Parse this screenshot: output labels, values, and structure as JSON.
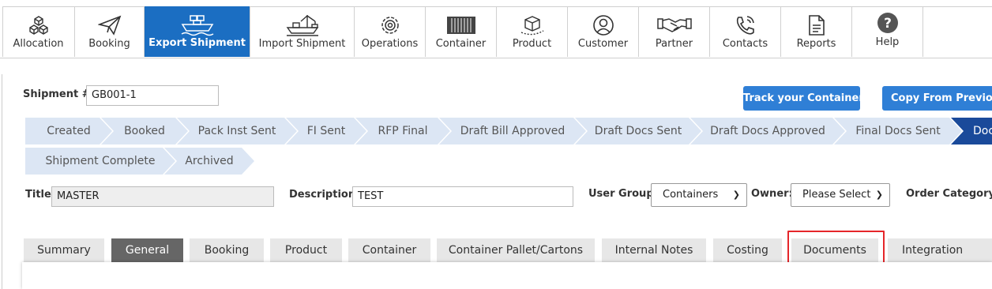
{
  "nav": {
    "items": [
      {
        "label": "Allocation",
        "icon": "allocation-icon"
      },
      {
        "label": "Booking",
        "icon": "paper-plane-icon"
      },
      {
        "label": "Export Shipment",
        "icon": "ship-icon",
        "active": true
      },
      {
        "label": "Import Shipment",
        "icon": "crane-ship-icon"
      },
      {
        "label": "Operations",
        "icon": "gear-icon"
      },
      {
        "label": "Container",
        "icon": "container-icon"
      },
      {
        "label": "Product",
        "icon": "box-icon"
      },
      {
        "label": "Customer",
        "icon": "user-icon"
      },
      {
        "label": "Partner",
        "icon": "handshake-icon"
      },
      {
        "label": "Contacts",
        "icon": "phone-icon"
      },
      {
        "label": "Reports",
        "icon": "document-icon"
      },
      {
        "label": "Help",
        "icon": "help-icon"
      }
    ],
    "active_color": "#1b6ec2"
  },
  "shipment": {
    "label": "Shipment #:",
    "value": "GB001-1"
  },
  "actions": {
    "track": "Track your Container",
    "copy": "Copy From Previous I"
  },
  "status": {
    "steps": [
      "Created",
      "Booked",
      "Pack Inst Sent",
      "FI Sent",
      "RFP Final",
      "Draft Bill Approved",
      "Draft Docs Sent",
      "Draft Docs Approved",
      "Final Docs Sent",
      "Doc",
      "Shipment Complete",
      "Archived"
    ],
    "current": "Doc",
    "colors": {
      "step": "#dce6f4",
      "current": "#1a4a9a"
    }
  },
  "form": {
    "title_label": "Title:",
    "title_value": "MASTER",
    "description_label": "Description:",
    "description_value": "TEST",
    "user_group_label": "User Group:",
    "user_group_value": "Containers",
    "owner_label": "Owner:",
    "owner_value": "Please Select",
    "order_category_label": "Order Category:"
  },
  "tabs": {
    "items": [
      "Summary",
      "General",
      "Booking",
      "Product",
      "Container",
      "Container Pallet/Cartons",
      "Internal Notes",
      "Costing",
      "Documents",
      "Integration"
    ],
    "active": "General",
    "highlighted": "Documents",
    "highlight_color": "#e5262a"
  }
}
